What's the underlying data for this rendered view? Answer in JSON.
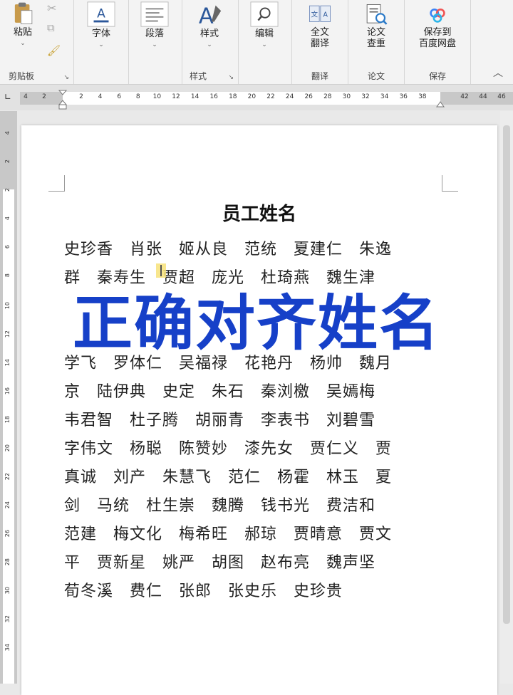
{
  "ribbon": {
    "clipboard": {
      "paste": "粘贴",
      "group_label": "剪贴板"
    },
    "font": {
      "label": "字体"
    },
    "paragraph": {
      "label": "段落"
    },
    "styles": {
      "label": "样式",
      "group_label": "样式"
    },
    "editing": {
      "label": "编辑"
    },
    "translate": {
      "label_line1": "全文",
      "label_line2": "翻译",
      "group_label": "翻译"
    },
    "paper": {
      "label_line1": "论文",
      "label_line2": "查重",
      "group_label": "论文"
    },
    "save": {
      "label_line1": "保存到",
      "label_line2": "百度网盘",
      "group_label": "保存"
    }
  },
  "ruler": {
    "left_ticks": [
      "4",
      "2"
    ],
    "ticks": [
      "2",
      "4",
      "6",
      "8",
      "10",
      "12",
      "14",
      "16",
      "18",
      "20",
      "22",
      "24",
      "26",
      "28",
      "30",
      "32",
      "34",
      "36",
      "38"
    ],
    "right_ticks": [
      "42",
      "44",
      "46"
    ],
    "vertical_ticks": [
      "4",
      "2",
      "2",
      "4",
      "6",
      "8",
      "10",
      "12",
      "14",
      "16",
      "18",
      "20",
      "22",
      "24",
      "26",
      "28",
      "30",
      "32",
      "34"
    ]
  },
  "document": {
    "title": "员工姓名",
    "lines": [
      "史珍香　肖张　姬从良　范统　夏建仁　朱逸",
      "群　秦寿生　贾超　庞光　杜琦燕　魏生津",
      "",
      "",
      "学飞　罗体仁　吴福禄　花艳丹　杨帅　魏月",
      "京　陆伊典　史定　朱石　秦浏檄　吴嫣梅",
      "韦君智　杜子腾　胡丽青　李表书　刘碧雪",
      "字伟文　杨聪　陈赞妙　漆先女　贾仁义　贾",
      "真诚　刘产　朱慧飞　范仁　杨霍　林玉　夏",
      "剑　马统　杜生崇　魏腾　钱书光　费洁和",
      "范建　梅文化　梅希旺　郝琼　贾晴意　贾文",
      "平　贾新星　姚严　胡图　赵布亮　魏声坚",
      "荀冬溪　费仁　张郎　张史乐　史珍贵"
    ]
  },
  "overlay": {
    "text": "正确对齐姓名"
  },
  "colors": {
    "overlay": "#1640c8",
    "ribbon_bg": "#f3f3f3",
    "accent_blue": "#2b579a"
  }
}
